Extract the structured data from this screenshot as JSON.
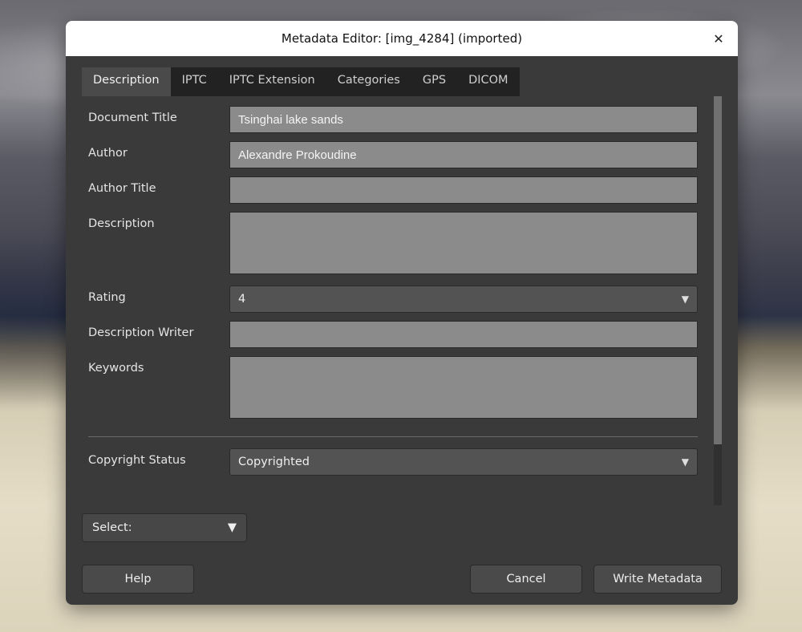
{
  "titlebar": {
    "text": "Metadata Editor: [img_4284] (imported)"
  },
  "tabs": [
    {
      "label": "Description"
    },
    {
      "label": "IPTC"
    },
    {
      "label": "IPTC Extension"
    },
    {
      "label": "Categories"
    },
    {
      "label": "GPS"
    },
    {
      "label": "DICOM"
    }
  ],
  "active_tab": 0,
  "form": {
    "document_title_label": "Document Title",
    "document_title_value": "Tsinghai lake sands",
    "author_label": "Author",
    "author_value": "Alexandre Prokoudine",
    "author_title_label": "Author Title",
    "author_title_value": "",
    "description_label": "Description",
    "description_value": "",
    "rating_label": "Rating",
    "rating_value": "4",
    "description_writer_label": "Description Writer",
    "description_writer_value": "",
    "keywords_label": "Keywords",
    "keywords_value": "",
    "copyright_status_label": "Copyright Status",
    "copyright_status_value": "Copyrighted"
  },
  "bottom_select": {
    "label": "Select:"
  },
  "buttons": {
    "help": "Help",
    "cancel": "Cancel",
    "write": "Write Metadata"
  }
}
